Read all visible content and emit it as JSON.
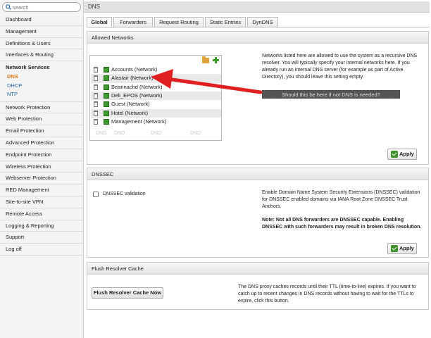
{
  "sidebar": {
    "search_placeholder": "search",
    "items_top": [
      "Dashboard",
      "Management",
      "Definitions & Users",
      "Interfaces & Routing"
    ],
    "group": {
      "title": "Network Services",
      "subs": [
        "DNS",
        "DHCP",
        "NTP"
      ],
      "active": "DNS"
    },
    "items_bottom": [
      "Network Protection",
      "Web Protection",
      "Email Protection",
      "Advanced Protection",
      "Endpoint Protection",
      "Wireless Protection",
      "Webserver Protection",
      "RED Management",
      "Site-to-site VPN",
      "Remote Access",
      "Logging & Reporting",
      "Support",
      "Log off"
    ]
  },
  "page": {
    "title": "DNS"
  },
  "tabs": [
    "Global",
    "Forwarders",
    "Request Routing",
    "Static Entries",
    "DynDNS"
  ],
  "allowed": {
    "title": "Allowed Networks",
    "networks": [
      "Accounts (Network)",
      "Alastair (Network)",
      "Beannachd (Network)",
      "Deli_EPOS (Network)",
      "Guest (Network)",
      "Hotel (Network)",
      "Management (Network)"
    ],
    "ghost": [
      "DND",
      "DND",
      "DND",
      "DND"
    ],
    "help": "Networks listed here are allowed to use the system as a recursive DNS resolver. You will typically specify your internal networks here. If you already run an internal DNS server (for example as part of Active Directory), you should leave this setting empty.",
    "callout": "Should this be here if not DNS is needed?",
    "apply": "Apply"
  },
  "dnssec": {
    "title": "DNSSEC",
    "checkbox_label": "DNSSEC validation",
    "help": "Enable Domain Name System Security Extensions (DNSSEC) validation for DNSSEC enabled domains via IANA Root Zone DNSSEC Trust Anchors.",
    "note": "Note: Not all DNS forwarders are DNSSEC capable. Enabling DNSSEC with such forwarders may result in broken DNS resolution.",
    "apply": "Apply"
  },
  "flush": {
    "title": "Flush Resolver Cache",
    "button": "Flush Resolver Cache Now",
    "help": "The DNS proxy caches records until their TTL (time-to-live) expires. If you want to catch up to recent changes in DNS records without having to wait for the TTLs to expire, click this button."
  },
  "colors": {
    "active_nav": "#e8761b",
    "link": "#1f5fa8",
    "arrow": "#e02020",
    "accept": "#3d9a2e"
  }
}
